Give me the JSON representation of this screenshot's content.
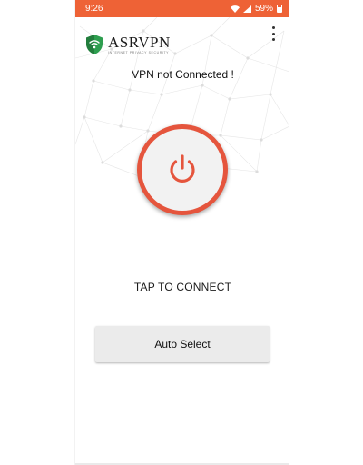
{
  "status_bar": {
    "time": "9:26",
    "battery": "59%",
    "icons": [
      "wifi-icon",
      "signal-icon",
      "battery-icon"
    ],
    "color": "#ee6236"
  },
  "header": {
    "app_name": "ASRVPN",
    "tagline": "INTERNET PRIVACY SECURITY",
    "logo_icon": "shield-wifi-icon",
    "menu_icon": "more-vert-icon"
  },
  "main": {
    "connection_status": "VPN not Connected !",
    "power_icon": "power-icon",
    "tap_label": "TAP TO CONNECT",
    "server_button_label": "Auto Select"
  },
  "colors": {
    "accent": "#e5553d",
    "shield_green": "#2e9e4f",
    "button_bg": "#ebebeb"
  }
}
